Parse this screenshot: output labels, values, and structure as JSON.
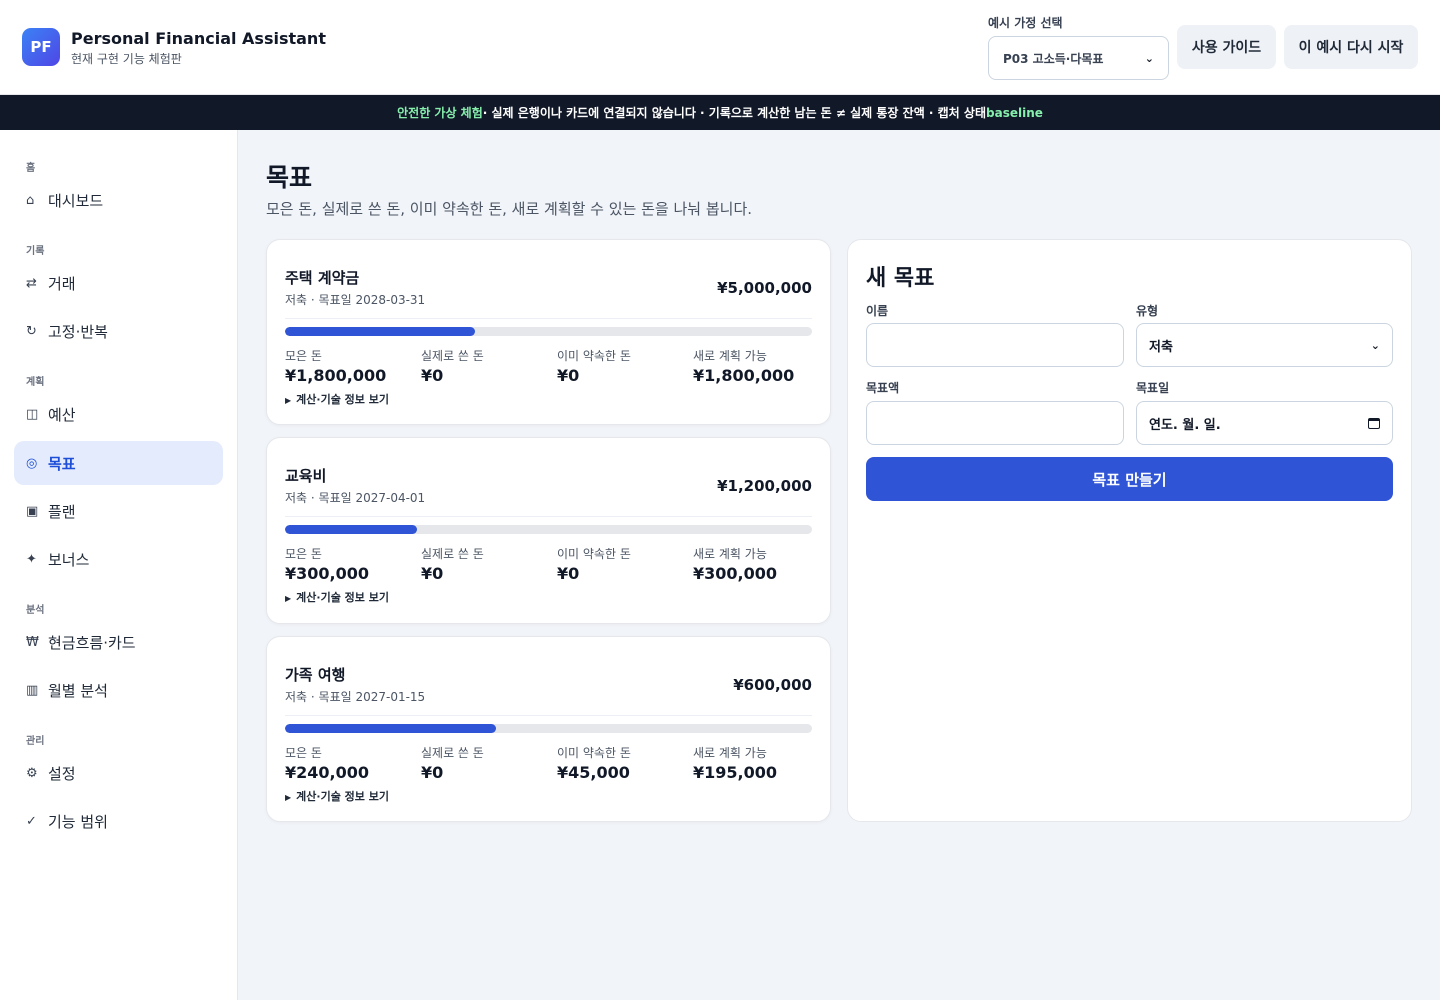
{
  "header": {
    "logo": "PF",
    "title": "Personal Financial Assistant",
    "subtitle": "현재 구현 기능 체험판",
    "scenario_label": "예시 가정 선택",
    "scenario_value": "P03 고소득·다목표",
    "guide_button": "사용 가이드",
    "restart_button": "이 예시 다시 시작"
  },
  "banner": {
    "highlight": "안전한 가상 체험",
    "text": " · 실제 은행이나 카드에 연결되지 않습니다 · 기록으로 계산한 남는 돈 ≠ 실제 통장 잔액 · 캡처 상태 ",
    "state": "baseline"
  },
  "sidebar": {
    "sections": [
      "홈",
      "기록",
      "계획",
      "분석",
      "관리"
    ],
    "items": [
      {
        "label": "대시보드",
        "icon": "⌂"
      },
      {
        "label": "거래",
        "icon": "⇄"
      },
      {
        "label": "고정·반복",
        "icon": "↻"
      },
      {
        "label": "예산",
        "icon": "◫"
      },
      {
        "label": "목표",
        "icon": "◎"
      },
      {
        "label": "플랜",
        "icon": "▣"
      },
      {
        "label": "보너스",
        "icon": "✦"
      },
      {
        "label": "현금흐름·카드",
        "icon": "₩"
      },
      {
        "label": "월별 분석",
        "icon": "▥"
      },
      {
        "label": "설정",
        "icon": "⚙"
      },
      {
        "label": "기능 범위",
        "icon": "✓"
      }
    ]
  },
  "page": {
    "title": "목표",
    "description": "모은 돈, 실제로 쓴 돈, 이미 약속한 돈, 새로 계획할 수 있는 돈을 나눠 봅니다."
  },
  "stat_labels": {
    "saved": "모은 돈",
    "spent": "실제로 쓴 돈",
    "committed": "이미 약속한 돈",
    "available": "새로 계획 가능"
  },
  "details_label": "계산·기술 정보 보기",
  "goals": [
    {
      "name": "주택 계약금",
      "meta": "저축 · 목표일 2028-03-31",
      "target": "¥5,000,000",
      "progress": 0.36,
      "saved": "¥1,800,000",
      "spent": "¥0",
      "committed": "¥0",
      "available": "¥1,800,000"
    },
    {
      "name": "교육비",
      "meta": "저축 · 목표일 2027-04-01",
      "target": "¥1,200,000",
      "progress": 0.25,
      "saved": "¥300,000",
      "spent": "¥0",
      "committed": "¥0",
      "available": "¥300,000"
    },
    {
      "name": "가족 여행",
      "meta": "저축 · 목표일 2027-01-15",
      "target": "¥600,000",
      "progress": 0.4,
      "saved": "¥240,000",
      "spent": "¥0",
      "committed": "¥45,000",
      "available": "¥195,000"
    }
  ],
  "form": {
    "title": "새 목표",
    "name_label": "이름",
    "name_value": "",
    "type_label": "유형",
    "type_value": "저축",
    "amount_label": "목표액",
    "amount_value": "",
    "date_label": "목표일",
    "date_placeholder": "연도. 월. 일.",
    "submit_label": "목표 만들기"
  },
  "colors": {
    "accent": "#2f54d6",
    "active_nav_bg": "#e3ebfd",
    "banner_bg": "#111827",
    "banner_highlight": "#86efac"
  }
}
